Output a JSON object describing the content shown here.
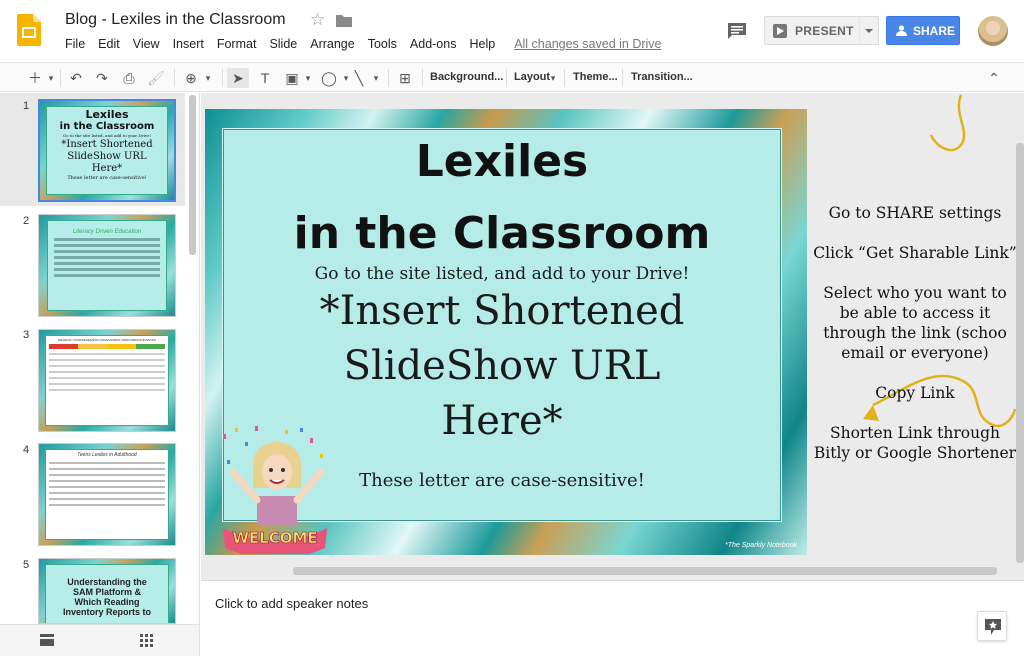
{
  "header": {
    "title": "Blog - Lexiles in the Classroom",
    "menu": [
      "File",
      "Edit",
      "View",
      "Insert",
      "Format",
      "Slide",
      "Arrange",
      "Tools",
      "Add-ons",
      "Help"
    ],
    "save_status": "All changes saved in Drive",
    "present_label": "PRESENT",
    "share_label": "SHARE"
  },
  "toolbar": {
    "background": "Background...",
    "layout": "Layout",
    "theme": "Theme...",
    "transition": "Transition..."
  },
  "filmstrip": {
    "slides": [
      {
        "number": "1",
        "lines": [
          "Lexiles",
          "in the Classroom",
          "Go to the site listed, and add to your Drive!",
          "*Insert Shortened",
          "SlideShow URL",
          "Here*",
          "These letter are case-sensitive!"
        ]
      },
      {
        "number": "2",
        "heading": "Literacy Driven Education"
      },
      {
        "number": "3",
        "heading": "READING COMPREHENSION ASSESSMENT PERFORMANCE BANDS"
      },
      {
        "number": "4",
        "heading": "Teens Lexiles in Adulthood"
      },
      {
        "number": "5",
        "lines": [
          "Understanding the",
          "SAM Platform &",
          "Which Reading",
          "Inventory Reports to"
        ]
      }
    ]
  },
  "slide": {
    "title_line1": "Lexiles",
    "title_line2": "in the Classroom",
    "instruction": "Go to the site listed, and add to your Drive!",
    "url_line1": "*Insert Shortened",
    "url_line2": "SlideShow URL",
    "url_line3": "Here*",
    "note": "These letter are case-sensitive!",
    "welcome": "WELCOME",
    "watermark": "*The Sparkly Notebook"
  },
  "side_notes": [
    "Go to SHARE settings",
    "Click “Get Sharable Link”",
    "Select who you want to be able to access it through the link (schoo email or everyone)",
    "Copy Link",
    "Shorten Link through Bitly or Google Shortener"
  ],
  "speaker_notes": {
    "placeholder": "Click to add speaker notes"
  },
  "colors": {
    "accent": "#4a86e8",
    "slide_panel": "#b6ece8",
    "gold": "#e0b21a"
  }
}
